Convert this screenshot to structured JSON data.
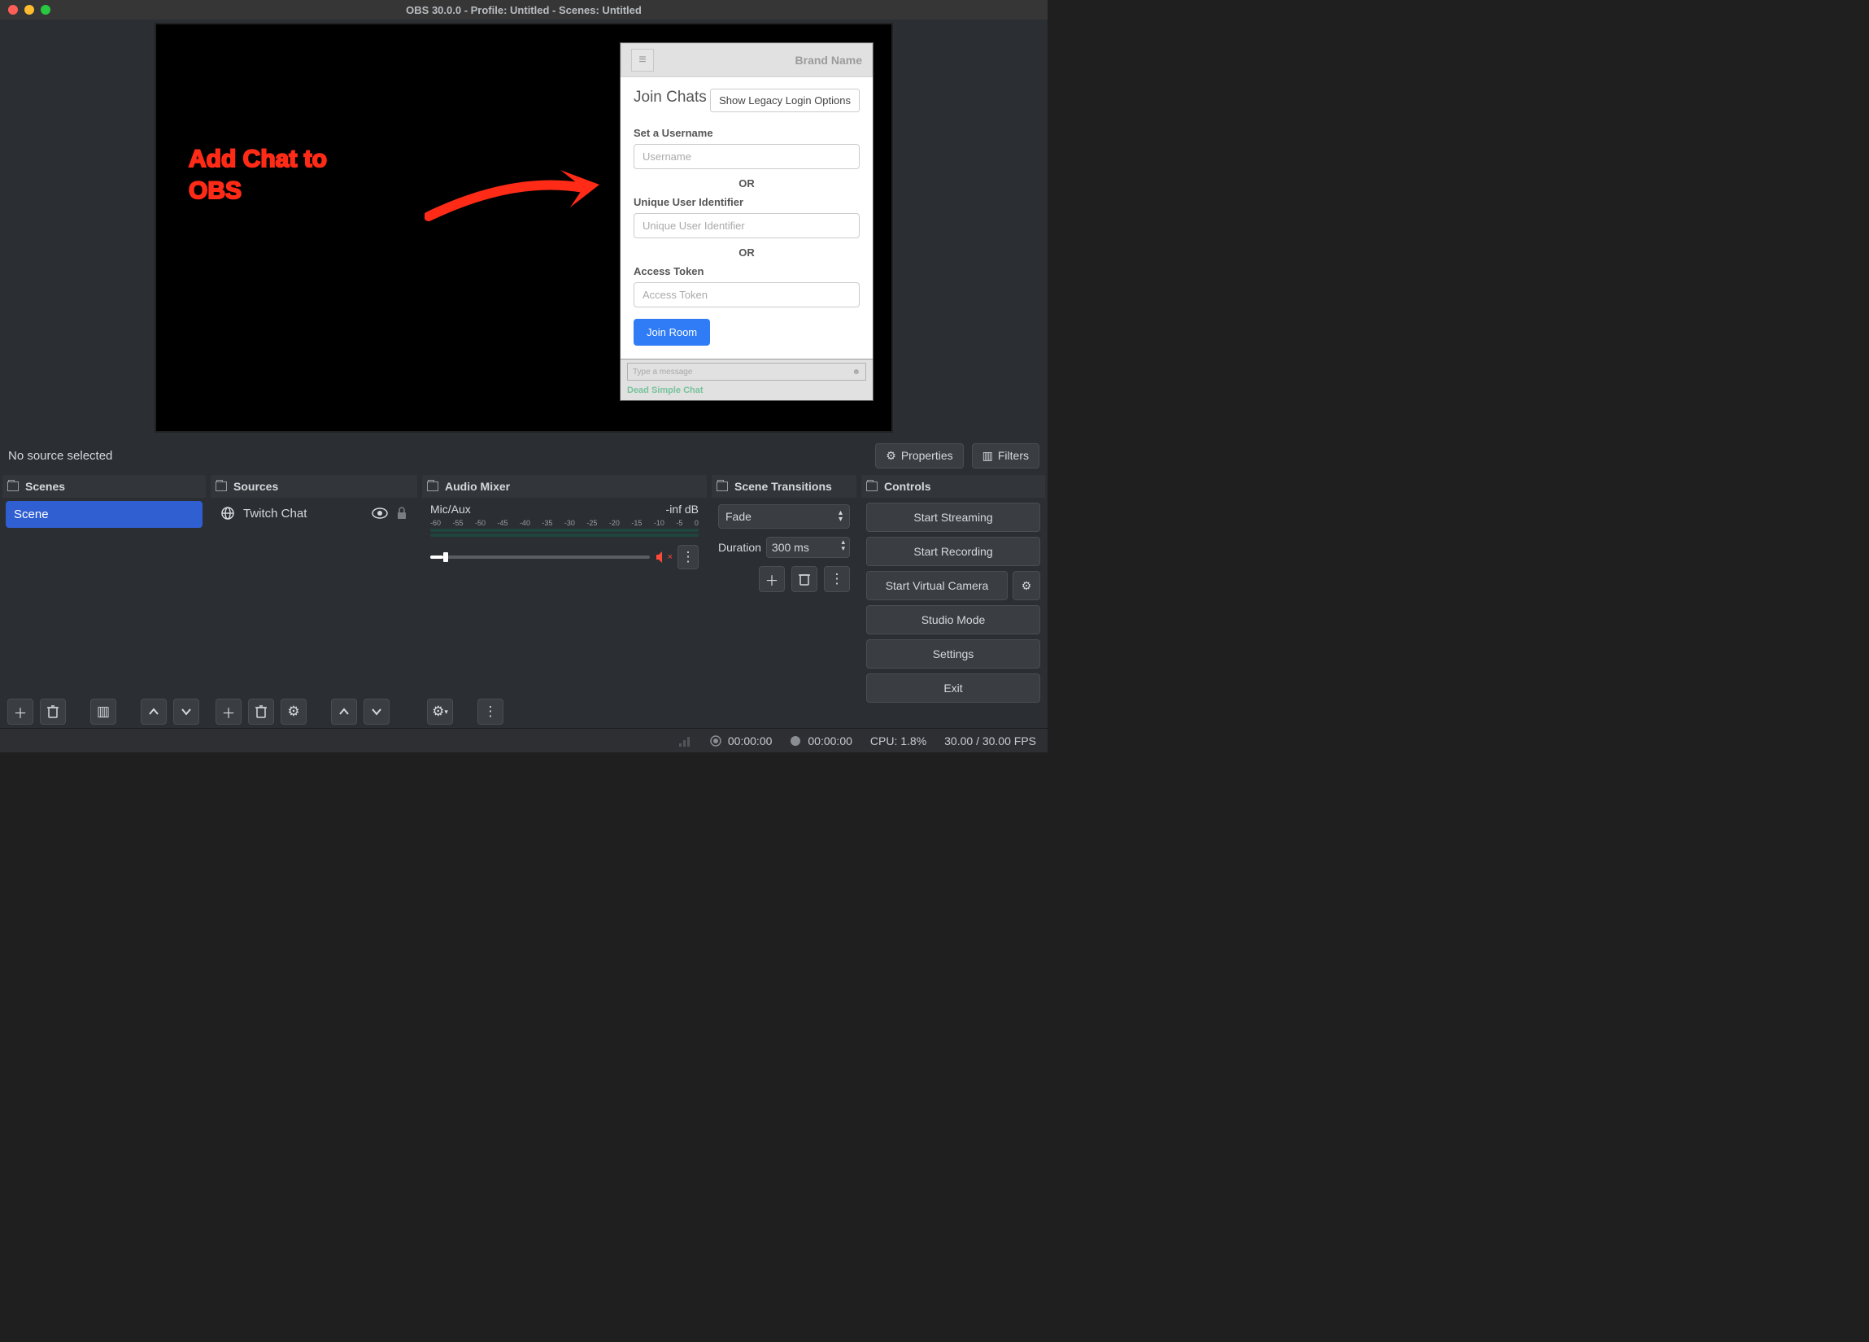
{
  "titlebar": {
    "title": "OBS 30.0.0 - Profile: Untitled - Scenes: Untitled"
  },
  "preview": {
    "annotation_line1": "Add Chat to",
    "annotation_line2": "OBS",
    "chat": {
      "brand": "Brand Name",
      "heading": "Join Chats",
      "legacy_button": "Show Legacy Login Options",
      "label_username": "Set a Username",
      "placeholder_username": "Username",
      "or": "OR",
      "label_uuid": "Unique User Identifier",
      "placeholder_uuid": "Unique User Identifier",
      "label_token": "Access Token",
      "placeholder_token": "Access Token",
      "join_button": "Join Room",
      "msg_placeholder": "Type a message",
      "footer_link": "Dead Simple Chat"
    }
  },
  "source_bar": {
    "status": "No source selected",
    "properties": "Properties",
    "filters": "Filters"
  },
  "scenes": {
    "title": "Scenes",
    "items": [
      "Scene"
    ]
  },
  "sources": {
    "title": "Sources",
    "items": [
      {
        "name": "Twitch Chat"
      }
    ]
  },
  "mixer": {
    "title": "Audio Mixer",
    "channel": "Mic/Aux",
    "level": "-inf dB",
    "scale": [
      "-60",
      "-55",
      "-50",
      "-45",
      "-40",
      "-35",
      "-30",
      "-25",
      "-20",
      "-15",
      "-10",
      "-5",
      "0"
    ]
  },
  "transitions": {
    "title": "Scene Transitions",
    "selected": "Fade",
    "duration_label": "Duration",
    "duration_value": "300 ms"
  },
  "controls": {
    "title": "Controls",
    "buttons": {
      "stream": "Start Streaming",
      "record": "Start Recording",
      "virtual_cam": "Start Virtual Camera",
      "studio": "Studio Mode",
      "settings": "Settings",
      "exit": "Exit"
    }
  },
  "statusbar": {
    "live_time": "00:00:00",
    "rec_time": "00:00:00",
    "cpu": "CPU: 1.8%",
    "fps": "30.00 / 30.00 FPS"
  }
}
